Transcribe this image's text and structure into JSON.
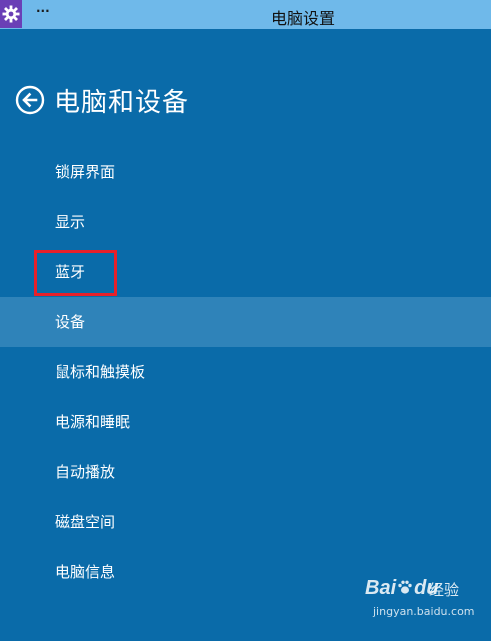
{
  "window": {
    "title": "电脑设置",
    "menu_label": "···",
    "app_icon": "gear-icon",
    "titlebar_color": "#6fb9ea",
    "app_icon_color": "#6a3fb6"
  },
  "page": {
    "title": "电脑和设备",
    "back_icon": "back-arrow-circle-icon",
    "background_color": "#0a6ba9"
  },
  "nav": {
    "items": [
      {
        "label": "锁屏界面"
      },
      {
        "label": "显示"
      },
      {
        "label": "蓝牙"
      },
      {
        "label": "设备",
        "selected": true
      },
      {
        "label": "鼠标和触摸板"
      },
      {
        "label": "电源和睡眠"
      },
      {
        "label": "自动播放"
      },
      {
        "label": "磁盘空间"
      },
      {
        "label": "电脑信息"
      }
    ],
    "selected_color": "#2f83b9"
  },
  "annotation": {
    "highlight_color": "#e8202a"
  },
  "watermark": {
    "brand": "Bai",
    "brand_suffix": "du",
    "sub": "经验",
    "url": "jingyan.baidu.com"
  }
}
